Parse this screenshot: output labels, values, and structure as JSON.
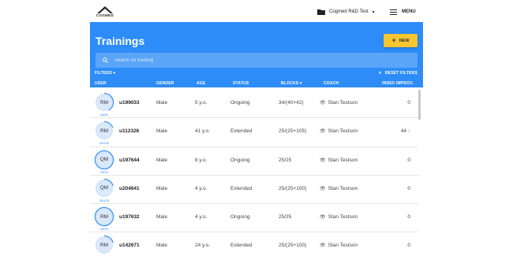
{
  "brand": {
    "logo_text": "COGMED"
  },
  "org_selector": {
    "label": "Cogmed R&D Test",
    "folder_icon": "folder-icon",
    "caret_icon": "caret-down-icon"
  },
  "menu": {
    "label": "MENU",
    "icon": "hamburger-icon"
  },
  "page": {
    "title": "Trainings"
  },
  "new_button": {
    "label": "NEW",
    "icon": "plus-icon"
  },
  "search": {
    "placeholder": "Search for training",
    "icon": "search-icon"
  },
  "filters": {
    "label": "FILTERS ▾",
    "reset_label": "RESET FILTERS"
  },
  "columns": {
    "user": "USER",
    "gender": "GENDER",
    "age": "AGE",
    "status": "STATUS",
    "blocks": "BLOCKS ▾",
    "coach": "COACH",
    "index": "INDEX IMPROV."
  },
  "rows": [
    {
      "initials": "RM",
      "progress": "34/82",
      "user": "u199033",
      "gender": "Male",
      "age": "5 y.o.",
      "status": "Ongoing",
      "blocks": "34/(40+42)",
      "coach": "Stan Testson",
      "improv": "0"
    },
    {
      "initials": "RM",
      "progress": "25/130",
      "user": "u112326",
      "gender": "Male",
      "age": "41 y.o.",
      "status": "Extended",
      "blocks": "25/(25+105)",
      "coach": "Stan Testson",
      "improv": "44 ↑"
    },
    {
      "initials": "QM",
      "progress": "25/25",
      "user": "u197644",
      "gender": "Male",
      "age": "8 y.o.",
      "status": "Ongoing",
      "blocks": "25/25",
      "coach": "Stan Testson",
      "improv": "0"
    },
    {
      "initials": "QM",
      "progress": "25/125",
      "user": "u204641",
      "gender": "Male",
      "age": "4 y.o.",
      "status": "Extended",
      "blocks": "25/(25+100)",
      "coach": "Stan Testson",
      "improv": "0"
    },
    {
      "initials": "RM",
      "progress": "25/25",
      "user": "u197632",
      "gender": "Male",
      "age": "4 y.o.",
      "status": "Ongoing",
      "blocks": "25/25",
      "coach": "Stan Testson",
      "improv": "0"
    },
    {
      "initials": "RM",
      "progress": "",
      "user": "u142671",
      "gender": "Male",
      "age": "24 y.o.",
      "status": "Extended",
      "blocks": "25/(25+100)",
      "coach": "Stan Testson",
      "improv": "0"
    }
  ],
  "colors": {
    "primary": "#2d8cf7",
    "accent": "#f8c630"
  }
}
